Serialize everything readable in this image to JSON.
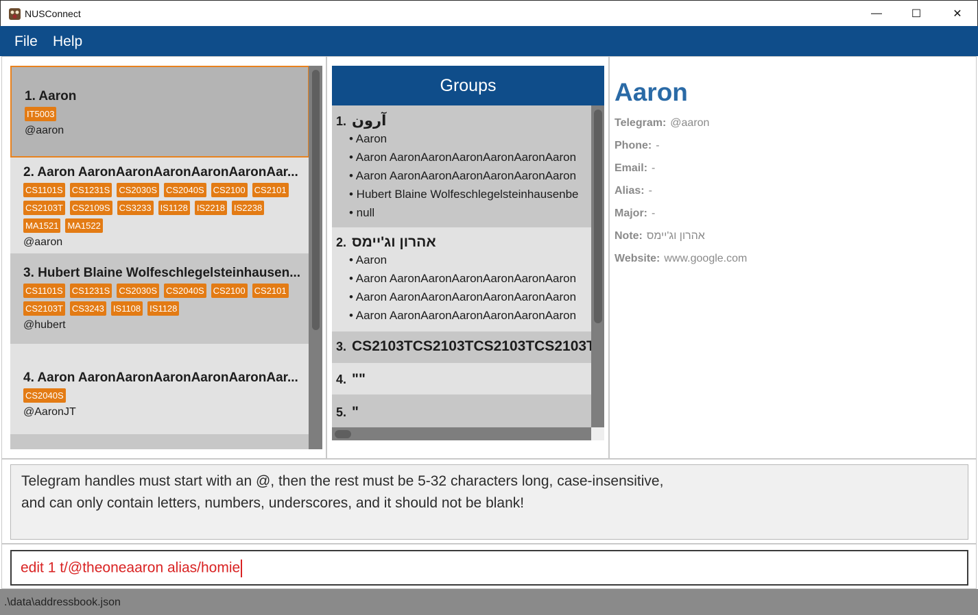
{
  "window": {
    "title": "NUSConnect",
    "icon": "app-icon",
    "controls": {
      "minimize": "—",
      "maximize": "☐",
      "close": "✕"
    }
  },
  "menu": {
    "file": "File",
    "help": "Help"
  },
  "persons": [
    {
      "name": "1. Aaron",
      "tags": [
        "IT5003"
      ],
      "handle": "@aaron"
    },
    {
      "name": "2. Aaron AaronAaronAaronAaronAaronAar...",
      "tags": [
        "CS1101S",
        "CS1231S",
        "CS2030S",
        "CS2040S",
        "CS2100",
        "CS2101",
        "CS2103T",
        "CS2109S",
        "CS3233",
        "IS1128",
        "IS2218",
        "IS2238",
        "MA1521",
        "MA1522"
      ],
      "handle": "@aaron"
    },
    {
      "name": "3. Hubert Blaine Wolfeschlegelsteinhausen...",
      "tags": [
        "CS1101S",
        "CS1231S",
        "CS2030S",
        "CS2040S",
        "CS2100",
        "CS2101",
        "CS2103T",
        "CS3243",
        "IS1108",
        "IS1128"
      ],
      "handle": "@hubert"
    },
    {
      "name": "4. Aaron AaronAaronAaronAaronAaronAar...",
      "tags": [
        "CS2040S"
      ],
      "handle": "@AaronJT"
    }
  ],
  "groups": {
    "header": "Groups",
    "items": [
      {
        "num": "1.",
        "title": "آرون",
        "members": [
          "• Aaron",
          "• Aaron AaronAaronAaronAaronAaronAaron",
          "• Aaron AaronAaronAaronAaronAaronAaron",
          "• Hubert Blaine Wolfeschlegelsteinhausenbe",
          "• null"
        ]
      },
      {
        "num": "2.",
        "title": "אהרון וג'יימס",
        "members": [
          "• Aaron",
          "• Aaron AaronAaronAaronAaronAaronAaron",
          "• Aaron AaronAaronAaronAaronAaronAaron",
          "• Aaron AaronAaronAaronAaronAaronAaron"
        ]
      },
      {
        "num": "3.",
        "title": "CS2103TCS2103TCS2103TCS2103T"
      },
      {
        "num": "4.",
        "title": "\"\""
      },
      {
        "num": "5.",
        "title": "\""
      }
    ]
  },
  "details": {
    "name": "Aaron",
    "telegram_label": "Telegram:",
    "telegram": "@aaron",
    "phone_label": "Phone:",
    "phone": "-",
    "email_label": "Email:",
    "email": "-",
    "alias_label": "Alias:",
    "alias": "-",
    "major_label": "Major:",
    "major": "-",
    "note_label": "Note:",
    "note": "אהרון וג'יימס",
    "website_label": "Website:",
    "website": "www.google.com"
  },
  "result": {
    "line1": "Telegram handles must start with an @, then the rest must be 5-32 characters long, case-insensitive,",
    "line2": "and can only contain letters, numbers, underscores, and it should not be blank!"
  },
  "command": {
    "value": "edit 1 t/@theoneaaron alias/homie"
  },
  "status": {
    "path": ".\\data\\addressbook.json"
  },
  "colors": {
    "accent": "#0f4d8a",
    "tag": "#e37b14",
    "selected_border": "#e8821e",
    "detail_name": "#2a6aa6",
    "command_text": "#d92323"
  }
}
